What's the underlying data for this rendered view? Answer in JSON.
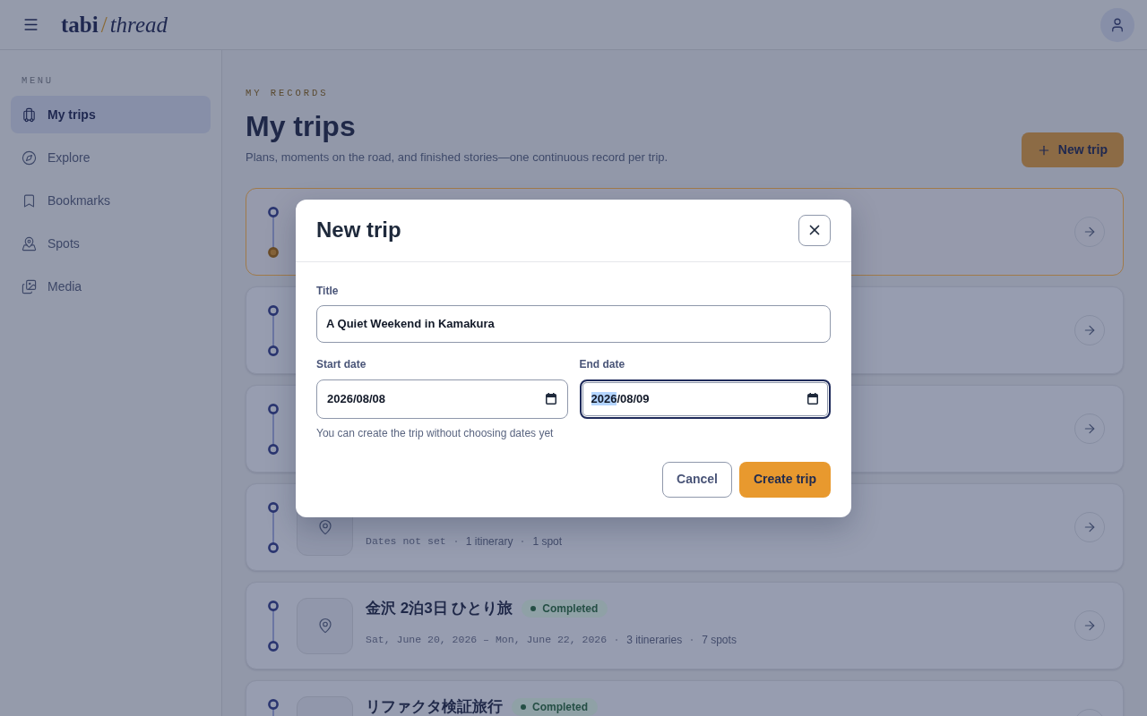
{
  "top_bar": {
    "logo": [
      {
        "text": "tabi",
        "kind": "strong"
      },
      {
        "text": "/",
        "kind": "accent"
      },
      {
        "text": "thread",
        "kind": "italic"
      }
    ]
  },
  "sidebar": {
    "heading": "MENU",
    "items": [
      {
        "label": "My trips",
        "selected": true
      },
      {
        "label": "Explore",
        "selected": false
      },
      {
        "label": "Bookmarks",
        "selected": false
      },
      {
        "label": "Spots",
        "selected": false
      },
      {
        "label": "Media",
        "selected": false
      }
    ]
  },
  "page_header": {
    "eyebrow": "MY RECORDS",
    "title": "My trips",
    "subtitle": "Plans, moments on the road, and finished stories—one continuous record per trip.",
    "action": "New trip"
  },
  "trips": [
    {
      "current": true
    },
    {
      "current": false
    },
    {
      "current": false
    },
    {
      "current": false,
      "meta": [
        {
          "text": "Dates not set",
          "kind": "date"
        },
        {
          "text": "1 itinerary",
          "kind": "count"
        },
        {
          "text": "1 spot",
          "kind": "count"
        }
      ]
    },
    {
      "current": false,
      "title": "金沢 2泊3日 ひとり旅",
      "status": {
        "label": "Completed",
        "kind": "completed"
      },
      "meta": [
        {
          "text": "Sat, June 20, 2026 – Mon, June 22, 2026",
          "kind": "date"
        },
        {
          "text": "3 itineraries",
          "kind": "count"
        },
        {
          "text": "7 spots",
          "kind": "count"
        }
      ]
    },
    {
      "current": false,
      "title": "リファクタ検証旅行",
      "status": {
        "label": "Completed",
        "kind": "completed"
      }
    }
  ],
  "dialog": {
    "title": "New trip",
    "title_field": {
      "label": "Title",
      "value": "A Quiet Weekend in Kamakura"
    },
    "date_fields": [
      {
        "label": "Start date",
        "focused": false,
        "segments": [
          {
            "text": "2026/08/08",
            "selected": false
          }
        ]
      },
      {
        "label": "End date",
        "focused": true,
        "segments": [
          {
            "text": "2026",
            "selected": true
          },
          {
            "text": "/08/09",
            "selected": false
          }
        ]
      }
    ],
    "hint": "You can create the trip without choosing dates yet",
    "buttons": [
      {
        "label": "Cancel",
        "kind": "secondary"
      },
      {
        "label": "Create trip",
        "kind": "primary"
      }
    ]
  }
}
